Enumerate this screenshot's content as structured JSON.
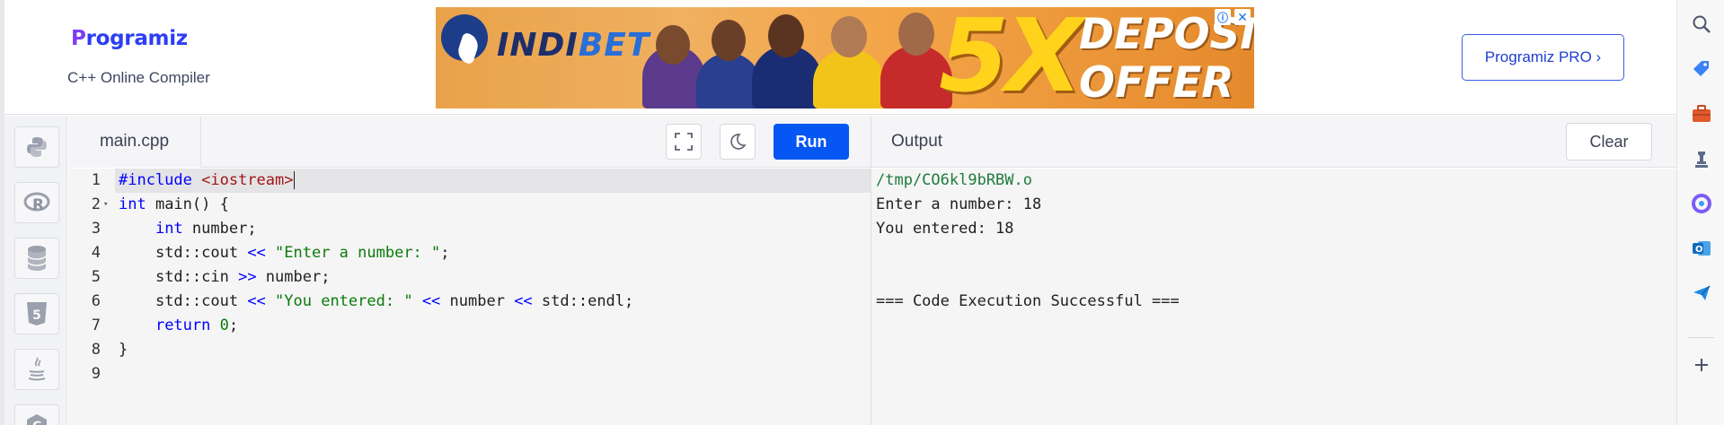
{
  "header": {
    "logo_text": "rogramiz",
    "logo_first_letter": "P",
    "subtitle": "C++ Online Compiler",
    "pro_button_label": "Programiz PRO ›"
  },
  "ad": {
    "brand_prefix": "INDI",
    "brand_suffix": "BET",
    "big_text": "5X",
    "line1": "DEPOSIT",
    "line2": "OFFER",
    "choices_icon": "ⓘ",
    "close_icon": "✕"
  },
  "languages": [
    {
      "name": "python-icon"
    },
    {
      "name": "r-lang-icon"
    },
    {
      "name": "database-icon"
    },
    {
      "name": "html5-icon"
    },
    {
      "name": "java-icon"
    },
    {
      "name": "c-lang-icon"
    }
  ],
  "editor": {
    "file_name": "main.cpp",
    "run_label": "Run",
    "lines": [
      "1",
      "2",
      "3",
      "4",
      "5",
      "6",
      "7",
      "8",
      "9"
    ],
    "code": {
      "l1_kw": "#include ",
      "l1_hdr": "<iostream>",
      "l2_kw": "int",
      "l2_rest": " main() {",
      "l3_kw": "int",
      "l3_rest": " number;",
      "l4_a": "std::cout ",
      "l4_op": "<<",
      "l4_str": " \"Enter a number: \"",
      "l4_end": ";",
      "l5_a": "std::cin ",
      "l5_op": ">>",
      "l5_end": " number;",
      "l6_a": "std::cout ",
      "l6_op1": "<<",
      "l6_str": " \"You entered: \"",
      "l6_mid": " ",
      "l6_op2": "<<",
      "l6_num": " number ",
      "l6_op3": "<<",
      "l6_end": " std::endl;",
      "l7_kw": "return",
      "l7_num": " 0",
      "l7_end": ";",
      "l8": "}"
    }
  },
  "output": {
    "title": "Output",
    "clear_label": "Clear",
    "lines": [
      "/tmp/CO6kl9bRBW.o",
      "Enter a number: 18",
      "You entered: 18",
      "",
      "",
      "=== Code Execution Successful ==="
    ]
  },
  "edge_sidebar": [
    "search-icon",
    "tag-icon",
    "toolbox-icon",
    "chess-icon",
    "copilot-icon",
    "outlook-icon",
    "send-icon",
    "add-icon"
  ],
  "colors": {
    "run_button": "#0556f3",
    "brand_blue": "#2c3ef5",
    "keyword_blue": "#0000ff",
    "string_red": "#a31515",
    "string_green": "#0b7a0b"
  }
}
